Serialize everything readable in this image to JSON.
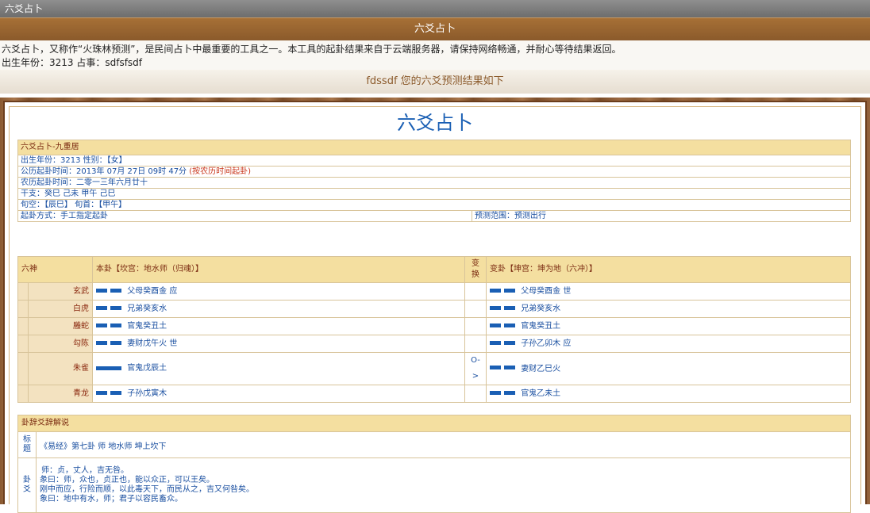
{
  "window": {
    "title": "六爻占卜"
  },
  "header": {
    "title": "六爻占卜"
  },
  "intro": {
    "line1": "六爻占卜，又称作“火珠林预测”，是民间占卜中最重要的工具之一。本工具的起卦结果来自于云端服务器，请保持网络畅通，并耐心等待结果返回。",
    "line2": "出生年份：3213  占事：sdfsfsdf"
  },
  "result_heading": "fdssdf 您的六爻预测结果如下",
  "report": {
    "title": "六爻占卜",
    "info_header": "六爻占卜-九重居",
    "birth": "出生年份：3213   性别：【女】",
    "solar_time": "公历起卦时间：2013年 07月 27日 09时 47分",
    "solar_note": "(按农历时间起卦)",
    "lunar_time": "农历起卦时间：二零一三年六月廿十",
    "ganzhi": "干支：癸巳 己未 甲午 己巳",
    "xunkong": "旬空：【辰巳】  旬首：【甲午】",
    "method": "起卦方式：手工指定起卦",
    "scope": "预测范围：预测出行"
  },
  "gua": {
    "col_god": "六神",
    "col_ben": "本卦【坎宫：地水师（归魂）】",
    "col_change": "变换",
    "col_bian": "变卦【坤宫：坤为地（六冲）】",
    "rows": [
      {
        "god": "玄武",
        "ben_line": "yin",
        "ben": "父母癸酉金   应",
        "change": "",
        "bian_line": "yin",
        "bian": "父母癸酉金   世"
      },
      {
        "god": "白虎",
        "ben_line": "yin",
        "ben": "兄弟癸亥水",
        "change": "",
        "bian_line": "yin",
        "bian": "兄弟癸亥水"
      },
      {
        "god": "螣蛇",
        "ben_line": "yin",
        "ben": "官鬼癸丑土",
        "change": "",
        "bian_line": "yin",
        "bian": "官鬼癸丑土"
      },
      {
        "god": "勾陈",
        "ben_line": "yin",
        "ben": "妻财戊午火   世",
        "change": "",
        "bian_line": "yin",
        "bian": "子孙乙卯木   应"
      },
      {
        "god": "朱雀",
        "ben_line": "yang",
        "ben": "官鬼戊辰土",
        "change": "O->",
        "bian_line": "yin",
        "bian": "妻财乙巳火"
      },
      {
        "god": "青龙",
        "ben_line": "yin",
        "ben": "子孙戊寅木",
        "change": "",
        "bian_line": "yin",
        "bian": "官鬼乙未土"
      }
    ]
  },
  "desc": {
    "header": "卦辞爻辞解说",
    "title_label": "标题",
    "title_text": "《易经》第七卦 师 地水师 坤上坎下",
    "body_label": "卦爻",
    "lines": [
      "师：贞，丈人，吉无咎。",
      "彖曰：师，众也，贞正也，能以众正，可以王矣。",
      "刚中而应，行险而顺，以此毒天下，而民从之，吉又何咎矣。",
      "象曰：地中有水，师；君子以容民畜众。"
    ]
  }
}
